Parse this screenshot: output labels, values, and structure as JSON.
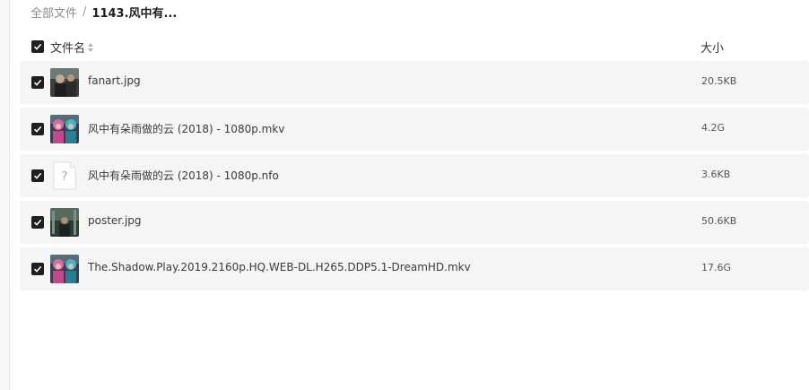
{
  "breadcrumb": {
    "root": "全部文件",
    "separator": "/",
    "current": "1143.风中有..."
  },
  "header": {
    "name_col": "文件名",
    "size_col": "大小",
    "select_all_checked": true
  },
  "files": [
    {
      "name": "fanart.jpg",
      "size": "20.5KB",
      "checked": true,
      "icon": "image-thumbnail-dark"
    },
    {
      "name": "风中有朵雨做的云 (2018) - 1080p.mkv",
      "size": "4.2G",
      "checked": true,
      "icon": "video-thumbnail-colorful"
    },
    {
      "name": "风中有朵雨做的云 (2018) - 1080p.nfo",
      "size": "3.6KB",
      "checked": true,
      "icon": "unknown-file-icon"
    },
    {
      "name": "poster.jpg",
      "size": "50.6KB",
      "checked": true,
      "icon": "image-thumbnail-dark"
    },
    {
      "name": "The.Shadow.Play.2019.2160p.HQ.WEB-DL.H265.DDP5.1-DreamHD.mkv",
      "size": "17.6G",
      "checked": true,
      "icon": "video-thumbnail-colorful"
    }
  ],
  "colors": {
    "row_bg": "#f5f5f6",
    "checkbox": "#1f1f1f",
    "breadcrumb_muted": "#8c8c8c"
  }
}
